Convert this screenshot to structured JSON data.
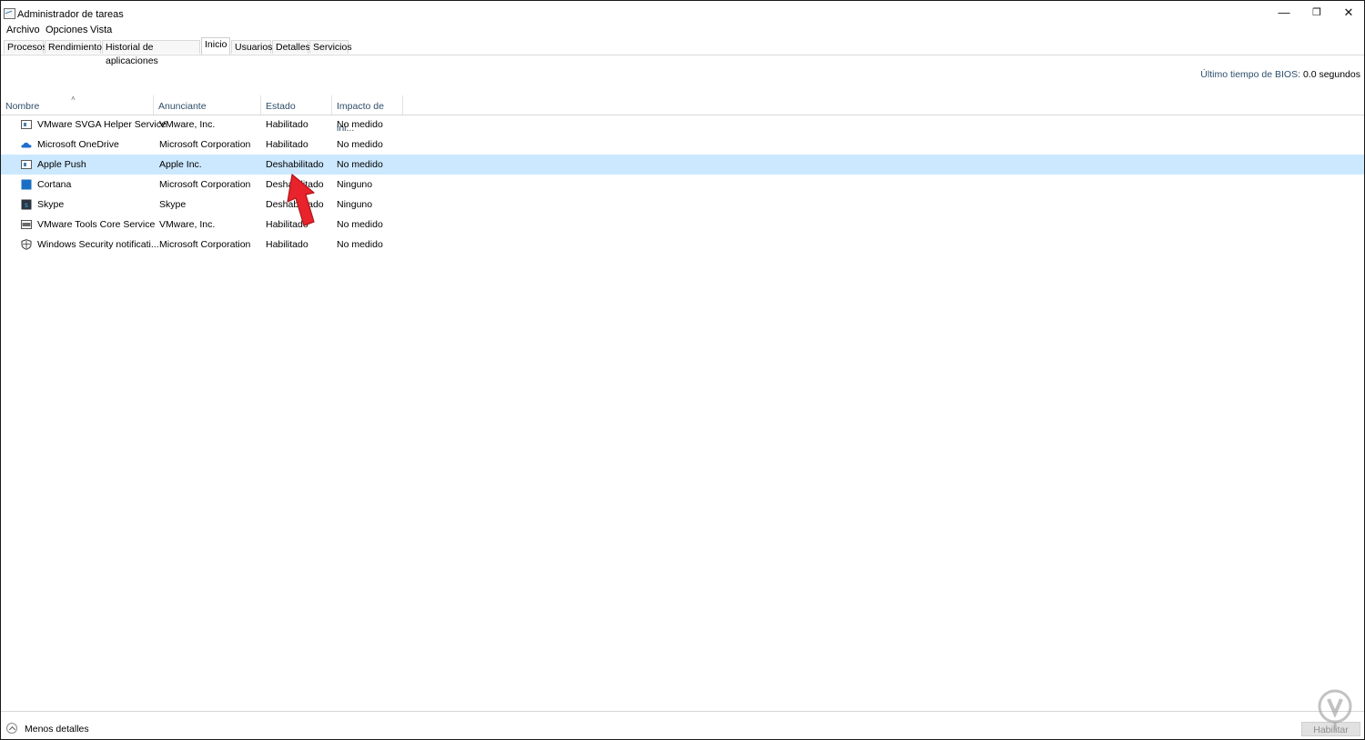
{
  "window": {
    "title": "Administrador de tareas",
    "minimize": "—",
    "restore": "❐",
    "close": "✕"
  },
  "menu": [
    "Archivo",
    "Opciones",
    "Vista"
  ],
  "tabs": [
    "Procesos",
    "Rendimiento",
    "Historial de aplicaciones",
    "Inicio",
    "Usuarios",
    "Detalles",
    "Servicios"
  ],
  "active_tab": "Inicio",
  "bios": {
    "label": "Último tiempo de BIOS:",
    "value": "0.0 segundos"
  },
  "columns": [
    "Nombre",
    "Anunciante",
    "Estado",
    "Impacto de ini..."
  ],
  "sort_indicator": "˄",
  "rows": [
    {
      "icon": "app-window-icon",
      "name": "VMware SVGA Helper Service",
      "publisher": "VMware, Inc.",
      "status": "Habilitado",
      "impact": "No medido",
      "selected": false
    },
    {
      "icon": "onedrive-cloud-icon",
      "name": "Microsoft OneDrive",
      "publisher": "Microsoft Corporation",
      "status": "Habilitado",
      "impact": "No medido",
      "selected": false
    },
    {
      "icon": "app-window-icon",
      "name": "Apple Push",
      "publisher": "Apple Inc.",
      "status": "Deshabilitado",
      "impact": "No medido",
      "selected": true
    },
    {
      "icon": "cortana-square-icon",
      "name": "Cortana",
      "publisher": "Microsoft Corporation",
      "status": "Deshabilitado",
      "impact": "Ninguno",
      "selected": false
    },
    {
      "icon": "skype-icon",
      "name": "Skype",
      "publisher": "Skype",
      "status": "Deshabilitado",
      "impact": "Ninguno",
      "selected": false
    },
    {
      "icon": "vmware-tools-icon",
      "name": "VMware Tools Core Service",
      "publisher": "VMware, Inc.",
      "status": "Habilitado",
      "impact": "No medido",
      "selected": false
    },
    {
      "icon": "shield-icon",
      "name": "Windows Security notificati...",
      "publisher": "Microsoft Corporation",
      "status": "Habilitado",
      "impact": "No medido",
      "selected": false
    }
  ],
  "footer": {
    "less_details": "Menos detalles",
    "enable_button": "Habilitar"
  },
  "colors": {
    "selected_row": "#cce8ff",
    "header_text": "#2f4d6a",
    "annotation_arrow": "#e8232b",
    "cortana_blue": "#1a6fc4",
    "onedrive_blue": "#1f6fcf"
  }
}
